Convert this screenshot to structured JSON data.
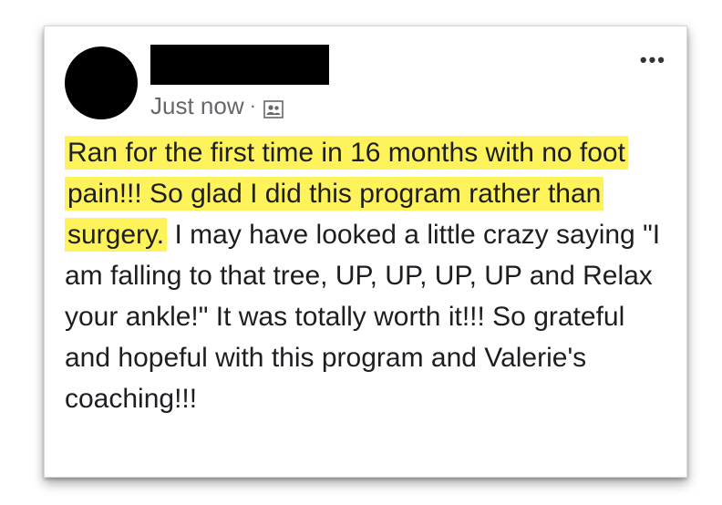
{
  "post": {
    "timestamp": "Just now",
    "separator": "·",
    "audience_icon": "friends-icon",
    "more_label": "•••",
    "highlighted_text": "Ran for the first time in 16 months with no foot pain!!!  So glad I did this program rather than surgery.",
    "body_text": " I may have looked a little crazy saying \"I am falling to that tree, UP, UP, UP, UP and Relax your ankle!\" It was totally worth it!!! So grateful and hopeful with this program and Valerie's coaching!!!"
  },
  "colors": {
    "highlight": "#fff35c",
    "meta_text": "#65676b",
    "body_text": "#1c1e21"
  }
}
